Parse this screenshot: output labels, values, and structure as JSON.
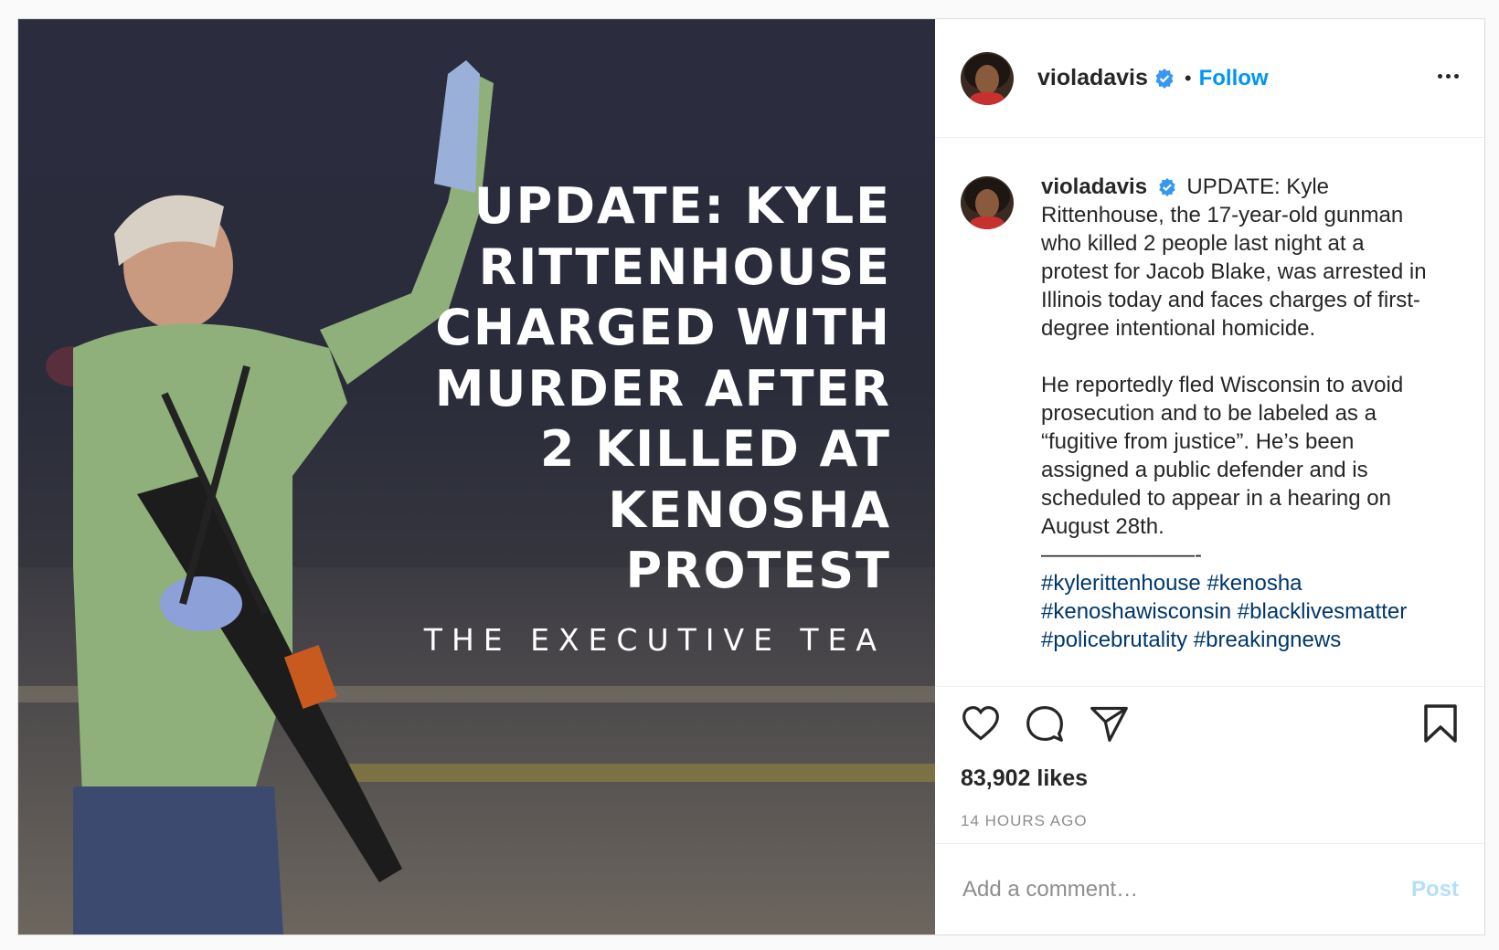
{
  "header": {
    "username": "violadavis",
    "separator": "•",
    "follow_label": "Follow"
  },
  "image": {
    "headline_lines": [
      "UPDATE: KYLE",
      "RITTENHOUSE",
      "CHARGED WITH",
      "MURDER AFTER",
      "2 KILLED AT",
      "KENOSHA",
      "PROTEST"
    ],
    "brand": "THE EXECUTIVE TEA"
  },
  "caption": {
    "username": "violadavis",
    "paragraph1": "UPDATE: Kyle Rittenhouse, the 17-year-old gunman who killed 2 people last night at a protest for Jacob Blake, was arrested in Illinois today and faces charges of first-degree intentional homicide.",
    "paragraph2": "He reportedly fled Wisconsin to avoid prosecution and to be labeled as a “fugitive from justice”. He’s been assigned a public defender and is scheduled to appear in a hearing on August 28th.",
    "divider": "———————-",
    "hashtags": "#kylerittenhouse #kenosha #kenoshawisconsin #blacklivesmatter #policebrutality #breakingnews"
  },
  "stats": {
    "likes": "83,902 likes",
    "time": "14 HOURS AGO"
  },
  "comment": {
    "placeholder": "Add a comment…",
    "post_label": "Post"
  },
  "icons": {
    "like": "heart-icon",
    "comment": "comment-icon",
    "share": "paper-plane-icon",
    "save": "bookmark-icon",
    "more": "more-options-icon",
    "verified": "verified-badge-icon"
  },
  "colors": {
    "link": "#0095f6",
    "hashtag": "#00376b",
    "verified": "#3897f0",
    "post_disabled": "#b2dffc"
  }
}
